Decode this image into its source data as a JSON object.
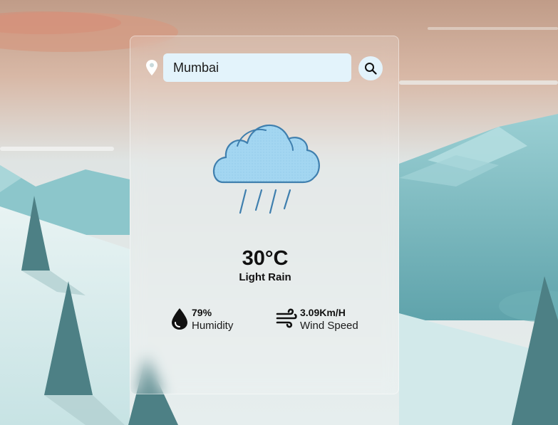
{
  "search": {
    "value": "Mumbai",
    "placeholder": ""
  },
  "weather": {
    "temperature": "30°C",
    "description": "Light Rain",
    "icon": "rain-cloud-icon"
  },
  "details": {
    "humidity_value": "79%",
    "humidity_label": "Humidity",
    "humidity_icon": "water-drop-icon",
    "wind_value": "3.09Km/H",
    "wind_label": "Wind Speed",
    "wind_icon": "wind-icon"
  },
  "colors": {
    "sky_top": "#c4a491",
    "sky_mid": "#d6ddda",
    "mountain": "#7fbdc3",
    "snow": "#d7ecec",
    "tree": "#4d7f84",
    "input_bg": "#e3f3fb",
    "cloud_fill": "#a3d6f1",
    "cloud_stroke": "#3f7fae"
  }
}
